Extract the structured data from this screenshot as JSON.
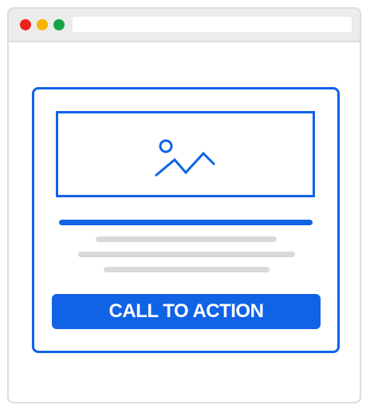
{
  "colors": {
    "accent": "#1163e6",
    "window_border": "#dcdcdc",
    "title_bar": "#ececec",
    "text_placeholder": "#d9d9d9",
    "dot_red": "#f0211c",
    "dot_yellow": "#f9b400",
    "dot_green": "#17a34a"
  },
  "window": {
    "controls": [
      "close",
      "minimize",
      "maximize"
    ]
  },
  "ad": {
    "image_icon": "image-icon",
    "cta_label": "CALL TO ACTION"
  }
}
